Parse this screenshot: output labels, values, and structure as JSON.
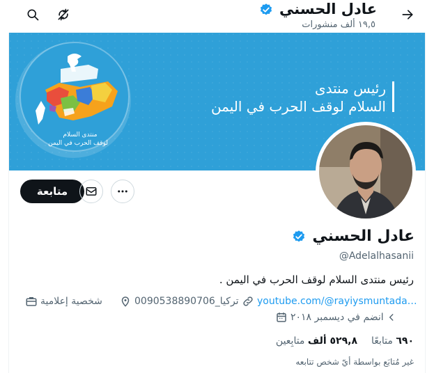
{
  "colors": {
    "accent": "#1d9bf0",
    "banner": "#2fa0d8",
    "muted": "#536471",
    "black": "#0f1419"
  },
  "header": {
    "name": "عادل الحسني",
    "posts_count": "١٩,٥ ألف منشورات"
  },
  "banner": {
    "line1": "رئيس منتدى",
    "line2": "السلام لوقف الحرب في اليمن",
    "logo_line1": "منتدى السلام",
    "logo_line2": "لوقف الحرب في اليمن"
  },
  "actions": {
    "follow_label": "متابعة"
  },
  "profile": {
    "name": "عادل الحسني",
    "handle": "@Adelalhasanii",
    "bio": "رئيس منتدى السلام لوقف الحرب في اليمن .",
    "link": "youtube.com/@rayiysmuntada…",
    "location": "تركيا_0090538890706",
    "category": "شخصية إعلامية",
    "joined": "انضم في ديسمبر ٢٠١٨",
    "following_count": "٦٩٠",
    "following_label": "متابعًا",
    "followers_count": "٥٢٩,٨ ألف",
    "followers_label": "متابِعين",
    "not_followed": "غير مُتابَع بواسطة أيّ شخص تتابعه"
  },
  "icons": [
    "back-arrow-icon",
    "search-icon",
    "sync-off-icon",
    "verified-badge-icon",
    "more-icon",
    "mail-icon",
    "briefcase-icon",
    "location-pin-icon",
    "link-icon",
    "calendar-icon",
    "chevron-left-icon"
  ]
}
